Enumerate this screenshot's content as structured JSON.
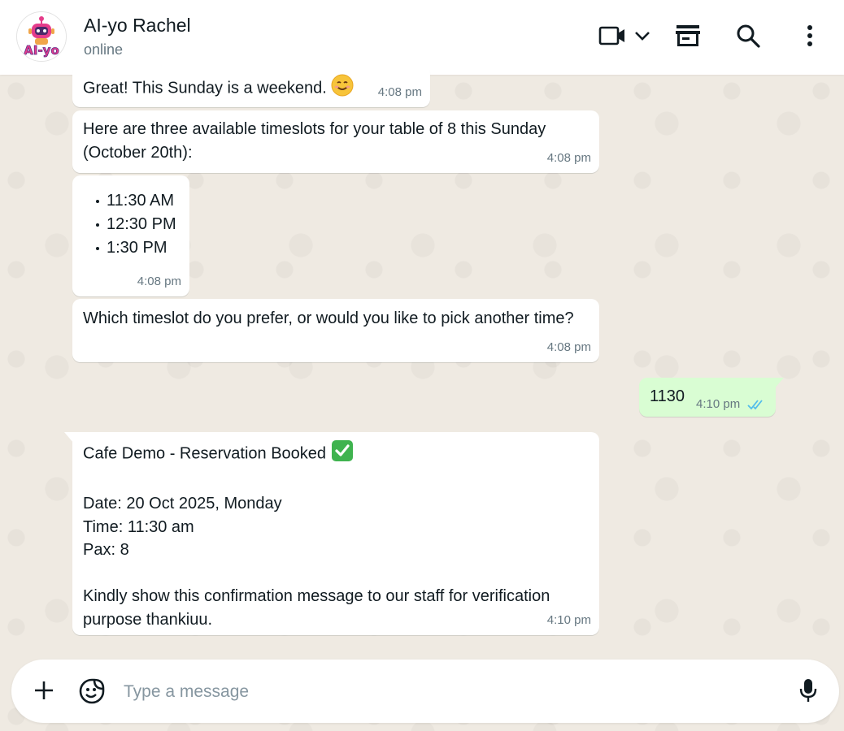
{
  "header": {
    "contact_name": "AI-yo Rachel",
    "status": "online",
    "avatar_text": "AI-yo",
    "icons": [
      "video-call-icon",
      "chevron-down-icon",
      "shop-icon",
      "search-icon",
      "more-vertical-icon"
    ]
  },
  "messages": [
    {
      "direction": "in",
      "text": "Great! This Sunday is a weekend.",
      "emoji": "smiling-face",
      "time": "4:08 pm"
    },
    {
      "direction": "in",
      "text": "Here are three available timeslots for your table of 8 this Sunday (October 20th):",
      "time": "4:08 pm"
    },
    {
      "direction": "in",
      "items": [
        "11:30 AM",
        "12:30 PM",
        "1:30 PM"
      ],
      "time": "4:08 pm"
    },
    {
      "direction": "in",
      "text": "Which timeslot do you prefer, or would you like to pick another time?",
      "time": "4:08 pm"
    },
    {
      "direction": "out",
      "text": "1130",
      "time": "4:10 pm",
      "status": "read"
    },
    {
      "direction": "in",
      "title": "Cafe Demo - Reservation Booked",
      "title_emoji": "check-mark-button",
      "line1": "Date: 20 Oct 2025, Monday",
      "line2": "Time: 11:30 am",
      "line3": "Pax: 8",
      "line4": "Kindly show this confirmation message to our staff for verification purpose thankiuu.",
      "time": "4:10 pm"
    }
  ],
  "composer": {
    "placeholder": "Type a message",
    "value": ""
  },
  "colors": {
    "background": "#efeae2",
    "outgoing_bubble": "#d9fdd3",
    "incoming_bubble": "#ffffff",
    "read_ticks": "#53bdeb",
    "secondary_text": "#667781"
  }
}
